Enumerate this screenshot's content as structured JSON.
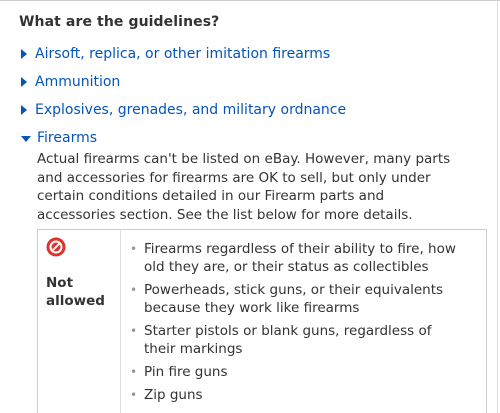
{
  "heading": "What are the guidelines?",
  "accordion": [
    {
      "label": "Airsoft, replica, or other imitation firearms",
      "expanded": false
    },
    {
      "label": "Ammunition",
      "expanded": false
    },
    {
      "label": "Explosives, grenades, and military ordnance",
      "expanded": false
    },
    {
      "label": "Firearms",
      "expanded": true
    }
  ],
  "firearms": {
    "description_lines": [
      "Actual firearms can't be listed on eBay. However, many parts",
      "and accessories for firearms are OK to sell, but only under",
      "certain conditions detailed in our Firearm parts and",
      "accessories section. See the list below for more details."
    ],
    "status_icon": "prohibited-icon",
    "status_line1": "Not",
    "status_line2": "allowed",
    "items": [
      {
        "line1": "Firearms regardless of their ability to fire, how",
        "line2": "old they are, or their status as collectibles"
      },
      {
        "line1": "Powerheads, stick guns, or their equivalents",
        "line2": "because they work like firearms"
      },
      {
        "line1": "Starter pistols or blank guns, regardless of",
        "line2": "their markings"
      },
      {
        "line1": "Pin fire guns"
      },
      {
        "line1": "Zip guns"
      }
    ]
  },
  "colors": {
    "link": "#0654ba",
    "text": "#333333",
    "prohibited_red": "#e0312e"
  }
}
